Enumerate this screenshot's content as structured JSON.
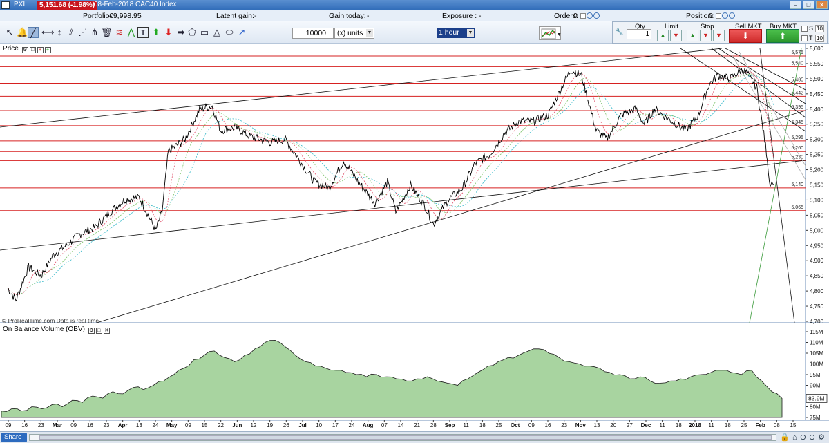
{
  "titlebar": {
    "app": "PXI",
    "price": "5,151.68 (-1.98%)",
    "info": "08-Feb-2018 CAC40 Index"
  },
  "infobar": {
    "portfolio_label": "Portfolio:",
    "portfolio_value": "€9,998.95",
    "latent_label": "Latent gain:",
    "latent_value": "-",
    "gain_label": "Gain today:",
    "gain_value": "-",
    "exposure_label": "Exposure :",
    "exposure_value": "-",
    "orders_label": "Orders:",
    "orders_value": "0",
    "position_label": "Position:",
    "position_value": "0"
  },
  "toolbar": {
    "quantity": "10000",
    "units": "(x) units",
    "timeframe": "1 hour"
  },
  "trade_panel": {
    "qty_label": "Qty",
    "qty_value": "1",
    "limit_label": "Limit",
    "stop_label": "Stop",
    "sell_label": "Sell MKT",
    "buy_label": "Buy MKT",
    "s_label": "S",
    "t_label": "T",
    "field_s": "10",
    "field_t": "10"
  },
  "price_panel": {
    "label": "Price",
    "credit": "© ProRealTime.com  Data is real time"
  },
  "obv_panel": {
    "label": "On Balance Volume (OBV)",
    "current": "83.9M"
  },
  "bottombar": {
    "share": "Share"
  },
  "chart_data": {
    "type": "line",
    "title": "08-Feb-2018 CAC40 Index",
    "timeframe": "1 hour",
    "y_ticks": [
      "5,600",
      "5,550",
      "5,500",
      "5,450",
      "5,400",
      "5,350",
      "5,300",
      "5,250",
      "5,200",
      "5,150",
      "5,100",
      "5,050",
      "5,000",
      "4,950",
      "4,900",
      "4,850",
      "4,800",
      "4,750",
      "4,700"
    ],
    "ylim": [
      4700,
      5600
    ],
    "horizontal_levels": [
      "5,575",
      "5,540",
      "5,485",
      "5,442",
      "5,395",
      "5,345",
      "5,295",
      "5,260",
      "5,230",
      "5,140",
      "5,065"
    ],
    "x_labels": [
      "09",
      "16",
      "23",
      "Mar",
      "09",
      "16",
      "23",
      "Apr",
      "13",
      "24",
      "May",
      "09",
      "15",
      "22",
      "Jun",
      "12",
      "19",
      "26",
      "Jul",
      "10",
      "17",
      "24",
      "Aug",
      "07",
      "14",
      "21",
      "28",
      "Sep",
      "11",
      "18",
      "25",
      "Oct",
      "09",
      "16",
      "23",
      "Nov",
      "13",
      "20",
      "27",
      "Dec",
      "11",
      "18",
      "2018",
      "11",
      "18",
      "25",
      "Feb",
      "08",
      "15"
    ],
    "series": [
      {
        "name": "CAC40",
        "points": [
          [
            "2017-02-06",
            4810
          ],
          [
            "2017-02-10",
            4770
          ],
          [
            "2017-02-16",
            4880
          ],
          [
            "2017-02-22",
            4850
          ],
          [
            "2017-02-28",
            4920
          ],
          [
            "2017-03-06",
            4950
          ],
          [
            "2017-03-13",
            4990
          ],
          [
            "2017-03-20",
            5010
          ],
          [
            "2017-03-27",
            5060
          ],
          [
            "2017-04-03",
            5100
          ],
          [
            "2017-04-10",
            5110
          ],
          [
            "2017-04-18",
            5000
          ],
          [
            "2017-04-21",
            5060
          ],
          [
            "2017-04-24",
            5260
          ],
          [
            "2017-05-02",
            5300
          ],
          [
            "2017-05-09",
            5400
          ],
          [
            "2017-05-15",
            5410
          ],
          [
            "2017-05-19",
            5330
          ],
          [
            "2017-05-26",
            5340
          ],
          [
            "2017-06-02",
            5310
          ],
          [
            "2017-06-12",
            5290
          ],
          [
            "2017-06-19",
            5300
          ],
          [
            "2017-06-26",
            5230
          ],
          [
            "2017-07-03",
            5160
          ],
          [
            "2017-07-10",
            5140
          ],
          [
            "2017-07-17",
            5230
          ],
          [
            "2017-07-24",
            5160
          ],
          [
            "2017-08-01",
            5090
          ],
          [
            "2017-08-07",
            5160
          ],
          [
            "2017-08-11",
            5060
          ],
          [
            "2017-08-18",
            5150
          ],
          [
            "2017-08-25",
            5080
          ],
          [
            "2017-08-29",
            5020
          ],
          [
            "2017-09-05",
            5100
          ],
          [
            "2017-09-12",
            5140
          ],
          [
            "2017-09-18",
            5220
          ],
          [
            "2017-09-25",
            5250
          ],
          [
            "2017-10-02",
            5320
          ],
          [
            "2017-10-09",
            5360
          ],
          [
            "2017-10-16",
            5360
          ],
          [
            "2017-10-23",
            5380
          ],
          [
            "2017-10-30",
            5480
          ],
          [
            "2017-11-03",
            5530
          ],
          [
            "2017-11-08",
            5510
          ],
          [
            "2017-11-15",
            5330
          ],
          [
            "2017-11-20",
            5300
          ],
          [
            "2017-11-27",
            5380
          ],
          [
            "2017-12-04",
            5400
          ],
          [
            "2017-12-08",
            5350
          ],
          [
            "2017-12-13",
            5400
          ],
          [
            "2017-12-19",
            5370
          ],
          [
            "2017-12-28",
            5330
          ],
          [
            "2018-01-03",
            5380
          ],
          [
            "2018-01-08",
            5480
          ],
          [
            "2018-01-12",
            5510
          ],
          [
            "2018-01-18",
            5500
          ],
          [
            "2018-01-24",
            5530
          ],
          [
            "2018-01-26",
            5520
          ],
          [
            "2018-01-31",
            5470
          ],
          [
            "2018-02-05",
            5240
          ],
          [
            "2018-02-06",
            5160
          ],
          [
            "2018-02-08",
            5151.68
          ]
        ]
      }
    ],
    "obv": {
      "name": "On Balance Volume (OBV)",
      "y_ticks": [
        "115M",
        "110M",
        "105M",
        "100M",
        "95M",
        "90M",
        "85M",
        "80M",
        "75M"
      ],
      "ylim": [
        75,
        115
      ],
      "values": [
        78,
        79,
        78,
        80,
        79,
        81,
        80,
        83,
        82,
        85,
        84,
        87,
        86,
        89,
        88,
        90,
        92,
        95,
        98,
        102,
        104,
        106,
        103,
        101,
        104,
        107,
        110,
        111,
        108,
        104,
        101,
        99,
        98,
        97,
        96,
        95,
        94,
        95,
        94,
        93,
        92,
        93,
        94,
        92,
        91,
        90,
        93,
        96,
        99,
        101,
        103,
        104,
        106,
        107,
        105,
        103,
        101,
        100,
        99,
        98,
        96,
        95,
        93,
        94,
        92,
        91,
        92,
        93,
        94,
        95,
        96,
        97,
        96,
        95,
        97,
        92,
        87,
        83.9
      ]
    },
    "grid": false,
    "legend": "none"
  }
}
